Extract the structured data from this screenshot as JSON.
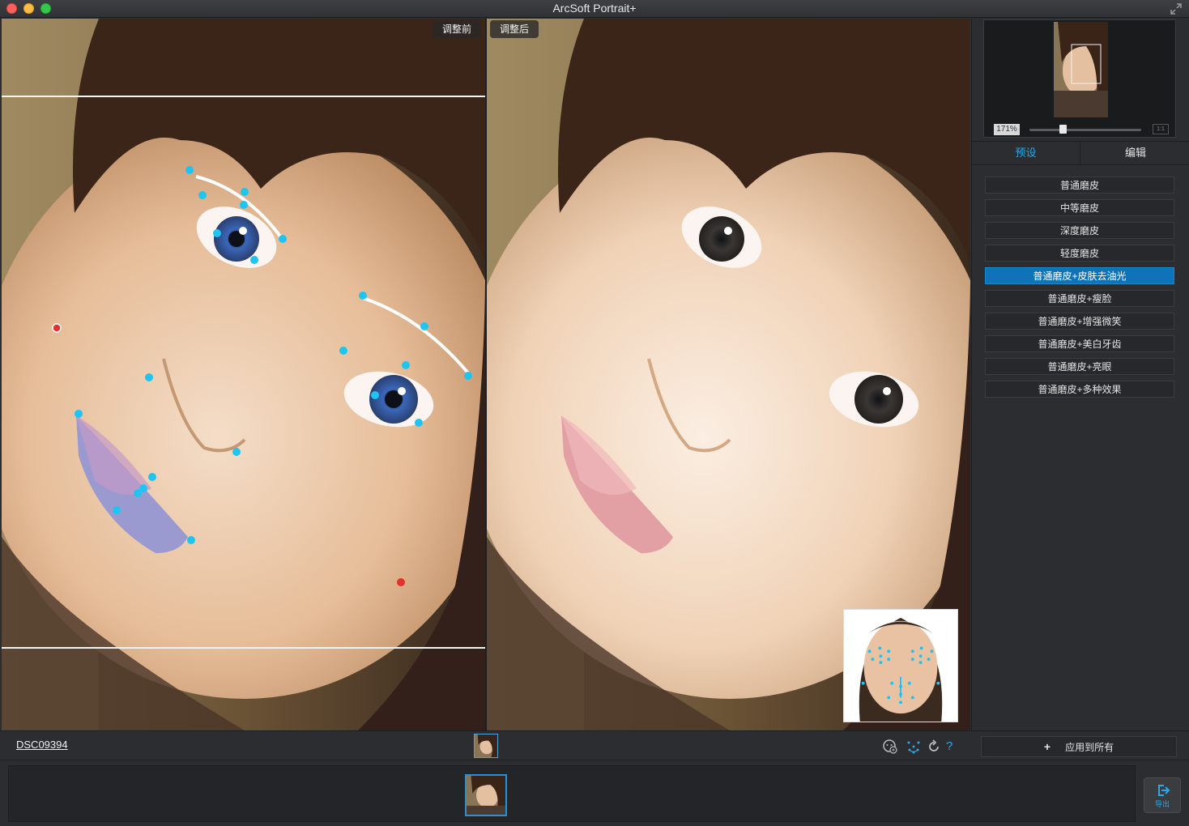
{
  "window": {
    "title": "ArcSoft Portrait+"
  },
  "panes": {
    "before_label": "调整前",
    "after_label": "调整后"
  },
  "navigator": {
    "zoom": "171%",
    "zoom_fraction": 0.3,
    "fit_label": "1:1"
  },
  "tabs": [
    {
      "label": "预设",
      "active": true
    },
    {
      "label": "编辑",
      "active": false
    }
  ],
  "presets": [
    {
      "label": "普通磨皮",
      "active": false
    },
    {
      "label": "中等磨皮",
      "active": false
    },
    {
      "label": "深度磨皮",
      "active": false
    },
    {
      "label": "轻度磨皮",
      "active": false
    },
    {
      "label": "普通磨皮+皮肤去油光",
      "active": true
    },
    {
      "label": "普通磨皮+瘦脸",
      "active": false
    },
    {
      "label": "普通磨皮+增强微笑",
      "active": false
    },
    {
      "label": "普通磨皮+美白牙齿",
      "active": false
    },
    {
      "label": "普通磨皮+亮眼",
      "active": false
    },
    {
      "label": "普通磨皮+多种效果",
      "active": false
    }
  ],
  "toolbar": {
    "filename": "DSC09394",
    "apply_all_icon": "+",
    "apply_all_label": "应用到所有",
    "icons": [
      "face-detect-icon",
      "face-points-icon",
      "reset-icon",
      "help-icon"
    ],
    "help_glyph": "?"
  },
  "filmstrip": {
    "export_label": "导出"
  },
  "colors": {
    "accent": "#2aa8e8",
    "active_preset": "#0f73b8",
    "landmark": "#20c4f0",
    "anchor_red": "#e53030"
  }
}
